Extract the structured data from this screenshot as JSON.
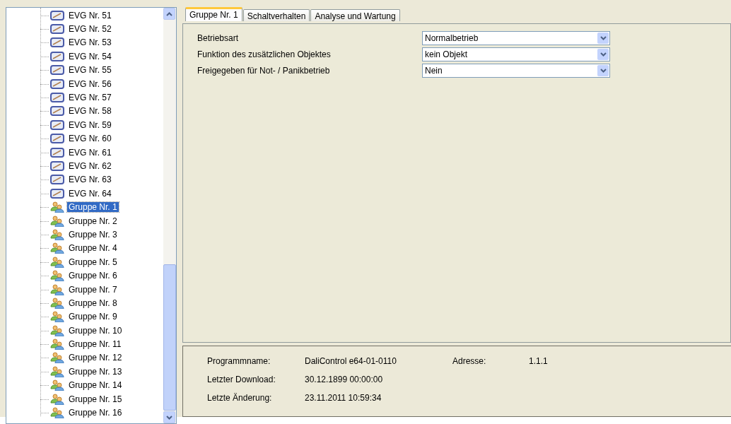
{
  "tree": {
    "items": [
      {
        "label": "EVG Nr. 51",
        "kind": "device",
        "selected": false
      },
      {
        "label": "EVG Nr. 52",
        "kind": "device",
        "selected": false
      },
      {
        "label": "EVG Nr. 53",
        "kind": "device",
        "selected": false
      },
      {
        "label": "EVG Nr. 54",
        "kind": "device",
        "selected": false
      },
      {
        "label": "EVG Nr. 55",
        "kind": "device",
        "selected": false
      },
      {
        "label": "EVG Nr. 56",
        "kind": "device",
        "selected": false
      },
      {
        "label": "EVG Nr. 57",
        "kind": "device",
        "selected": false
      },
      {
        "label": "EVG Nr. 58",
        "kind": "device",
        "selected": false
      },
      {
        "label": "EVG Nr. 59",
        "kind": "device",
        "selected": false
      },
      {
        "label": "EVG Nr. 60",
        "kind": "device",
        "selected": false
      },
      {
        "label": "EVG Nr. 61",
        "kind": "device",
        "selected": false
      },
      {
        "label": "EVG Nr. 62",
        "kind": "device",
        "selected": false
      },
      {
        "label": "EVG Nr. 63",
        "kind": "device",
        "selected": false
      },
      {
        "label": "EVG Nr. 64",
        "kind": "device",
        "selected": false
      },
      {
        "label": "Gruppe Nr. 1",
        "kind": "group",
        "selected": true
      },
      {
        "label": "Gruppe Nr. 2",
        "kind": "group",
        "selected": false
      },
      {
        "label": "Gruppe Nr. 3",
        "kind": "group",
        "selected": false
      },
      {
        "label": "Gruppe Nr. 4",
        "kind": "group",
        "selected": false
      },
      {
        "label": "Gruppe Nr. 5",
        "kind": "group",
        "selected": false
      },
      {
        "label": "Gruppe Nr. 6",
        "kind": "group",
        "selected": false
      },
      {
        "label": "Gruppe Nr. 7",
        "kind": "group",
        "selected": false
      },
      {
        "label": "Gruppe Nr. 8",
        "kind": "group",
        "selected": false
      },
      {
        "label": "Gruppe Nr. 9",
        "kind": "group",
        "selected": false
      },
      {
        "label": "Gruppe Nr. 10",
        "kind": "group",
        "selected": false
      },
      {
        "label": "Gruppe Nr. 11",
        "kind": "group",
        "selected": false
      },
      {
        "label": "Gruppe Nr. 12",
        "kind": "group",
        "selected": false
      },
      {
        "label": "Gruppe Nr. 13",
        "kind": "group",
        "selected": false
      },
      {
        "label": "Gruppe Nr. 14",
        "kind": "group",
        "selected": false
      },
      {
        "label": "Gruppe Nr. 15",
        "kind": "group",
        "selected": false
      },
      {
        "label": "Gruppe Nr. 16",
        "kind": "group",
        "selected": false
      }
    ]
  },
  "tabs": [
    {
      "label": "Gruppe Nr. 1",
      "selected": true
    },
    {
      "label": "Schaltverhalten",
      "selected": false
    },
    {
      "label": "Analyse und Wartung",
      "selected": false
    }
  ],
  "parameters": [
    {
      "label": "Betriebsart",
      "value": "Normalbetrieb"
    },
    {
      "label": "Funktion des zusätzlichen Objektes",
      "value": "kein Objekt"
    },
    {
      "label": "Freigegeben für Not- / Panikbetrieb",
      "value": "Nein"
    }
  ],
  "info": {
    "program_label": "Programmname:",
    "program_value": "DaliControl  e64-01-0110",
    "address_label": "Adresse:",
    "address_value": "1.1.1",
    "rows": [
      {
        "label": "Letzter Download:",
        "value": "30.12.1899 00:00:00"
      },
      {
        "label": "Letzte Änderung:",
        "value": "23.11.2011 10:59:34"
      }
    ]
  }
}
